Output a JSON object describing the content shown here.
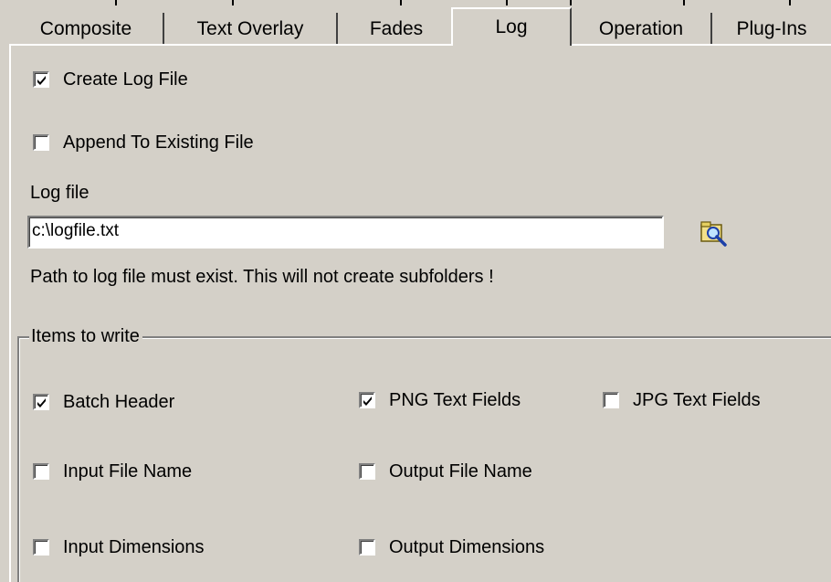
{
  "tabs": [
    {
      "label": "Composite",
      "active": false
    },
    {
      "label": "Text Overlay",
      "active": false
    },
    {
      "label": "Fades",
      "active": false
    },
    {
      "label": "Log",
      "active": true
    },
    {
      "label": "Operation",
      "active": false
    },
    {
      "label": "Plug-Ins",
      "active": false
    }
  ],
  "log": {
    "create_log_file": {
      "label": "Create Log File",
      "checked": true
    },
    "append_existing": {
      "label": "Append To Existing File",
      "checked": false
    },
    "log_file_label": "Log file",
    "log_file_value": "c:\\logfile.txt",
    "browse_icon": "folder-search-icon",
    "path_note": "Path to log file must exist. This will not create subfolders !"
  },
  "items_to_write": {
    "legend": "Items to write",
    "batch_header": {
      "label": "Batch Header",
      "checked": true
    },
    "png_text_fields": {
      "label": "PNG Text Fields",
      "checked": true
    },
    "jpg_text_fields": {
      "label": "JPG Text Fields",
      "checked": false
    },
    "input_file_name": {
      "label": "Input File Name",
      "checked": false
    },
    "output_file_name": {
      "label": "Output File Name",
      "checked": false
    },
    "input_dimensions": {
      "label": "Input Dimensions",
      "checked": false
    },
    "output_dimensions": {
      "label": "Output Dimensions",
      "checked": false
    }
  },
  "colors": {
    "face": "#d4d0c8",
    "shadow": "#808080",
    "highlight": "#ffffff"
  }
}
